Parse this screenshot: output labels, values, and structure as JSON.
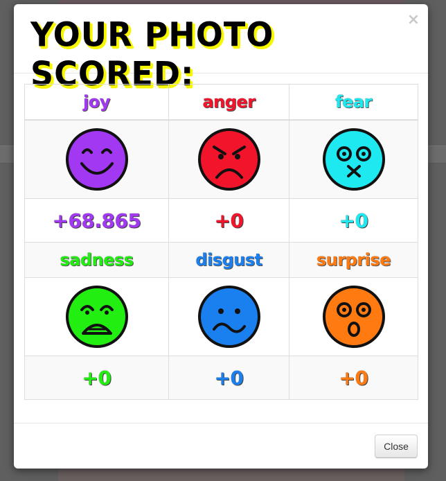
{
  "modal": {
    "title": "YOUR PHOTO SCORED:",
    "close_symbol": "×",
    "close_button_label": "Close"
  },
  "emotions": [
    {
      "key": "joy",
      "label": "joy",
      "score": "+68.865",
      "color": "#a238f2",
      "face_icon": "happy-face-icon"
    },
    {
      "key": "anger",
      "label": "anger",
      "score": "+0",
      "color": "#f2142a",
      "face_icon": "angry-face-icon"
    },
    {
      "key": "fear",
      "label": "fear",
      "score": "+0",
      "color": "#1ee8f0",
      "face_icon": "fearful-face-icon"
    },
    {
      "key": "sadness",
      "label": "sadness",
      "score": "+0",
      "color": "#22ee12",
      "face_icon": "sad-face-icon"
    },
    {
      "key": "disgust",
      "label": "disgust",
      "score": "+0",
      "color": "#1a7fef",
      "face_icon": "disgusted-face-icon"
    },
    {
      "key": "surprise",
      "label": "surprise",
      "score": "+0",
      "color": "#ff7a10",
      "face_icon": "surprised-face-icon"
    }
  ]
}
